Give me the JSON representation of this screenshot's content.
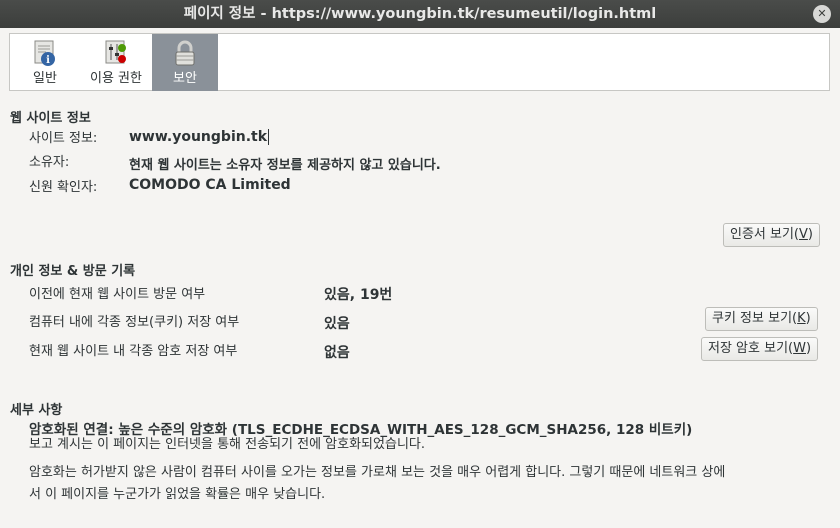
{
  "window": {
    "title": "페이지 정보 - https://www.youngbin.tk/resumeutil/login.html"
  },
  "tabs": [
    {
      "label": "일반",
      "icon": "info-page-icon"
    },
    {
      "label": "이용 권한",
      "icon": "permissions-icon"
    },
    {
      "label": "보안",
      "icon": "lock-icon",
      "active": true
    }
  ],
  "website": {
    "heading": "웹 사이트 정보",
    "site_label": "사이트 정보:",
    "site_value": "www.youngbin.tk",
    "owner_label": "소유자:",
    "owner_value": "현재 웹 사이트는 소유자 정보를 제공하지 않고 있습니다.",
    "verifier_label": "신원 확인자:",
    "verifier_value": "COMODO CA Limited",
    "cert_button": {
      "text": "인증서 보기(",
      "key": "V",
      "close": ")"
    }
  },
  "privacy": {
    "heading": "개인 정보 & 방문 기록",
    "rows": [
      {
        "label": "이전에 현재 웹 사이트 방문 여부",
        "value": "있음, 19번"
      },
      {
        "label": "컴퓨터 내에 각종 정보(쿠키) 저장 여부",
        "value": "있음"
      },
      {
        "label": "현재 웹 사이트 내 각종 암호 저장 여부",
        "value": "없음"
      }
    ],
    "cookie_button": {
      "text": "쿠키 정보 보기(",
      "key": "K",
      "close": ")"
    },
    "password_button": {
      "text": "저장 암호 보기(",
      "key": "W",
      "close": ")"
    }
  },
  "details": {
    "heading": "세부 사항",
    "connection": "암호화된 연결: 높은 수준의 암호화 (TLS_ECDHE_ECDSA_WITH_AES_128_GCM_SHA256, 128 비트키)",
    "line1": "보고 계시는 이 페이지는 인터넷을 통해 전송되기 전에 암호화되었습니다.",
    "line2a": "암호화는 허가받지 않은 사람이 컴퓨터 사이를 오가는 정보를 가로채 보는 것을 매우 어렵게 합니다. 그렇기 때문에 네트워크 상에",
    "line2b": "서 이 페이지를 누군가가 읽었을 확률은 매우 낮습니다."
  }
}
